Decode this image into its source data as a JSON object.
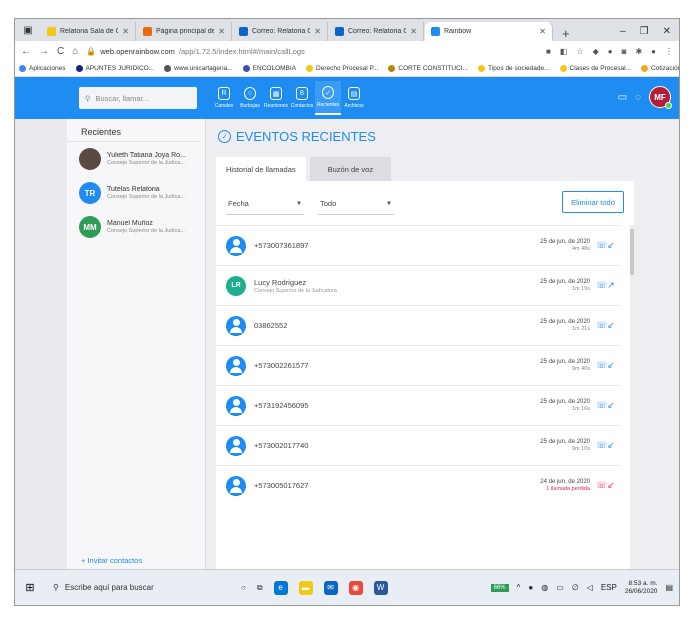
{
  "browser": {
    "tabs": [
      {
        "title": "Relatoria Sala de Casación C",
        "color": "#f5c518"
      },
      {
        "title": "Página principal de Microsof",
        "color": "#e86a10"
      },
      {
        "title": "Correo: Relatoria Civil Corte",
        "color": "#0a66c2"
      },
      {
        "title": "Correo: Relatoria Civil Corte",
        "color": "#0a66c2"
      },
      {
        "title": "Rainbow",
        "color": "#1e8cf0",
        "active": true
      }
    ],
    "url_host": "web.openrainbow.com",
    "url_path": "/app/1.72.5/index.html#/main/callLogs",
    "bookmarks": [
      "Aplicaciones",
      "APUNTES JURIDICO...",
      "www.unicartagena...",
      "ENCOLOMBIA",
      "Derecho Procesal P...",
      "CORTE CONSTITUCI...",
      "Tipos de sociedade...",
      "Clases de Procesal...",
      "Cotización al Siste..."
    ]
  },
  "header": {
    "search_placeholder": "Buscar, llamar...",
    "nav": [
      {
        "label": "Canales"
      },
      {
        "label": "Burbujas"
      },
      {
        "label": "Reuniones"
      },
      {
        "label": "Contactos"
      },
      {
        "label": "Recientes",
        "active": true
      },
      {
        "label": "Archivos"
      }
    ],
    "user_initials": "MF"
  },
  "recents": {
    "title": "Recientes",
    "items": [
      {
        "name": "Yulieth Tatiana Joya Ro...",
        "org": "Consejo Superior de la Judica...",
        "initials": "",
        "color": "#5a4a42"
      },
      {
        "name": "Tutelas Relatoria",
        "org": "Consejo Superior de la Judica...",
        "initials": "TR",
        "color": "#1e8cf0"
      },
      {
        "name": "Manuel Muñoz",
        "org": "Consejo Superior de la Judica...",
        "initials": "MM",
        "color": "#2e9c57"
      }
    ],
    "invite": "+  Invitar contactos"
  },
  "main": {
    "title": "EVENTOS RECIENTES",
    "tab_history": "Historial de llamadas",
    "tab_voicemail": "Buzón de voz",
    "filter_date": "Fecha",
    "filter_all": "Todo",
    "delete_all": "Eliminar todo",
    "calls": [
      {
        "number": "+573007361897",
        "org": "",
        "date": "25 de jun. de 2020",
        "duration": "4m 48s",
        "type": "in",
        "avatar": "default"
      },
      {
        "number": "Lucy Rodriguez",
        "org": "Consejo Superior de la Judicatura",
        "date": "25 de jun. de 2020",
        "duration": "1m 19s",
        "type": "out",
        "avatar": "LR"
      },
      {
        "number": "03862552",
        "org": "",
        "date": "25 de jun. de 2020",
        "duration": "1m 21s",
        "type": "in",
        "avatar": "default"
      },
      {
        "number": "+573002261577",
        "org": "",
        "date": "25 de jun. de 2020",
        "duration": "9m 40s",
        "type": "in",
        "avatar": "default"
      },
      {
        "number": "+573192456095",
        "org": "",
        "date": "25 de jun. de 2020",
        "duration": "1m 16s",
        "type": "in",
        "avatar": "default"
      },
      {
        "number": "+573002017740",
        "org": "",
        "date": "25 de jun. de 2020",
        "duration": "9m 10s",
        "type": "in",
        "avatar": "default"
      },
      {
        "number": "+573005017627",
        "org": "",
        "date": "24 de jun. de 2020",
        "duration": "1 llamada perdida",
        "type": "missed",
        "avatar": "default"
      }
    ]
  },
  "taskbar": {
    "search": "Escribe aquí para buscar",
    "battery": "66%",
    "lang": "ESP",
    "time": "8:53 a. m.",
    "date": "26/06/2020"
  }
}
